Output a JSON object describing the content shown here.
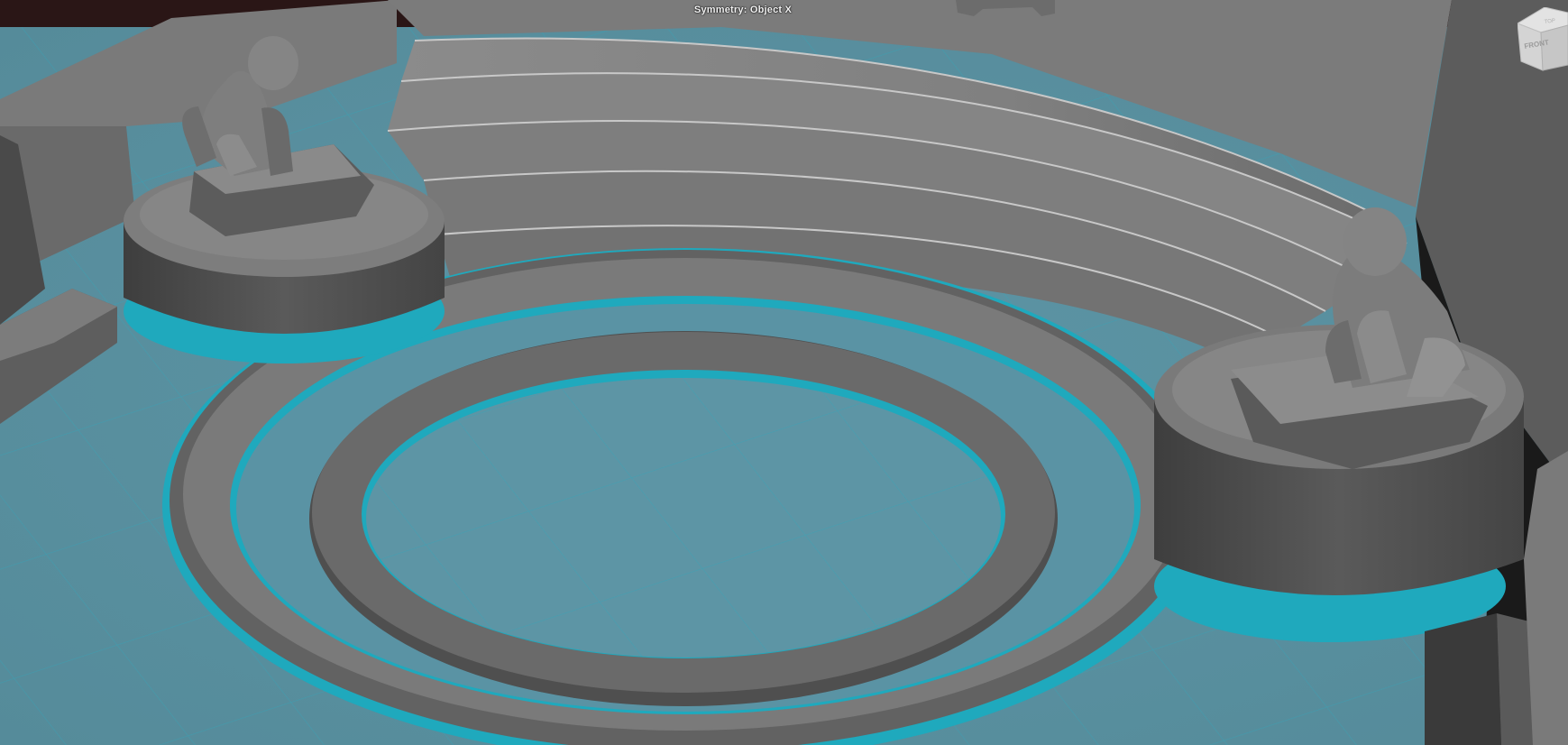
{
  "viewport": {
    "hud_title": "Symmetry: Object X",
    "view_cube_face_label": "FRONT",
    "view_cube_top_label": "TOP"
  },
  "colors": {
    "background_dark": "#2a1616",
    "water_cyan": "#5b93a3",
    "water_edge": "#1fa9bd",
    "stone_light": "#8a8a8a",
    "stone_mid": "#6e6e6e",
    "stone_dark": "#3a3a3a",
    "hud_text": "#f2f2f2"
  },
  "icons": {
    "view_cube": "view-cube-icon"
  }
}
